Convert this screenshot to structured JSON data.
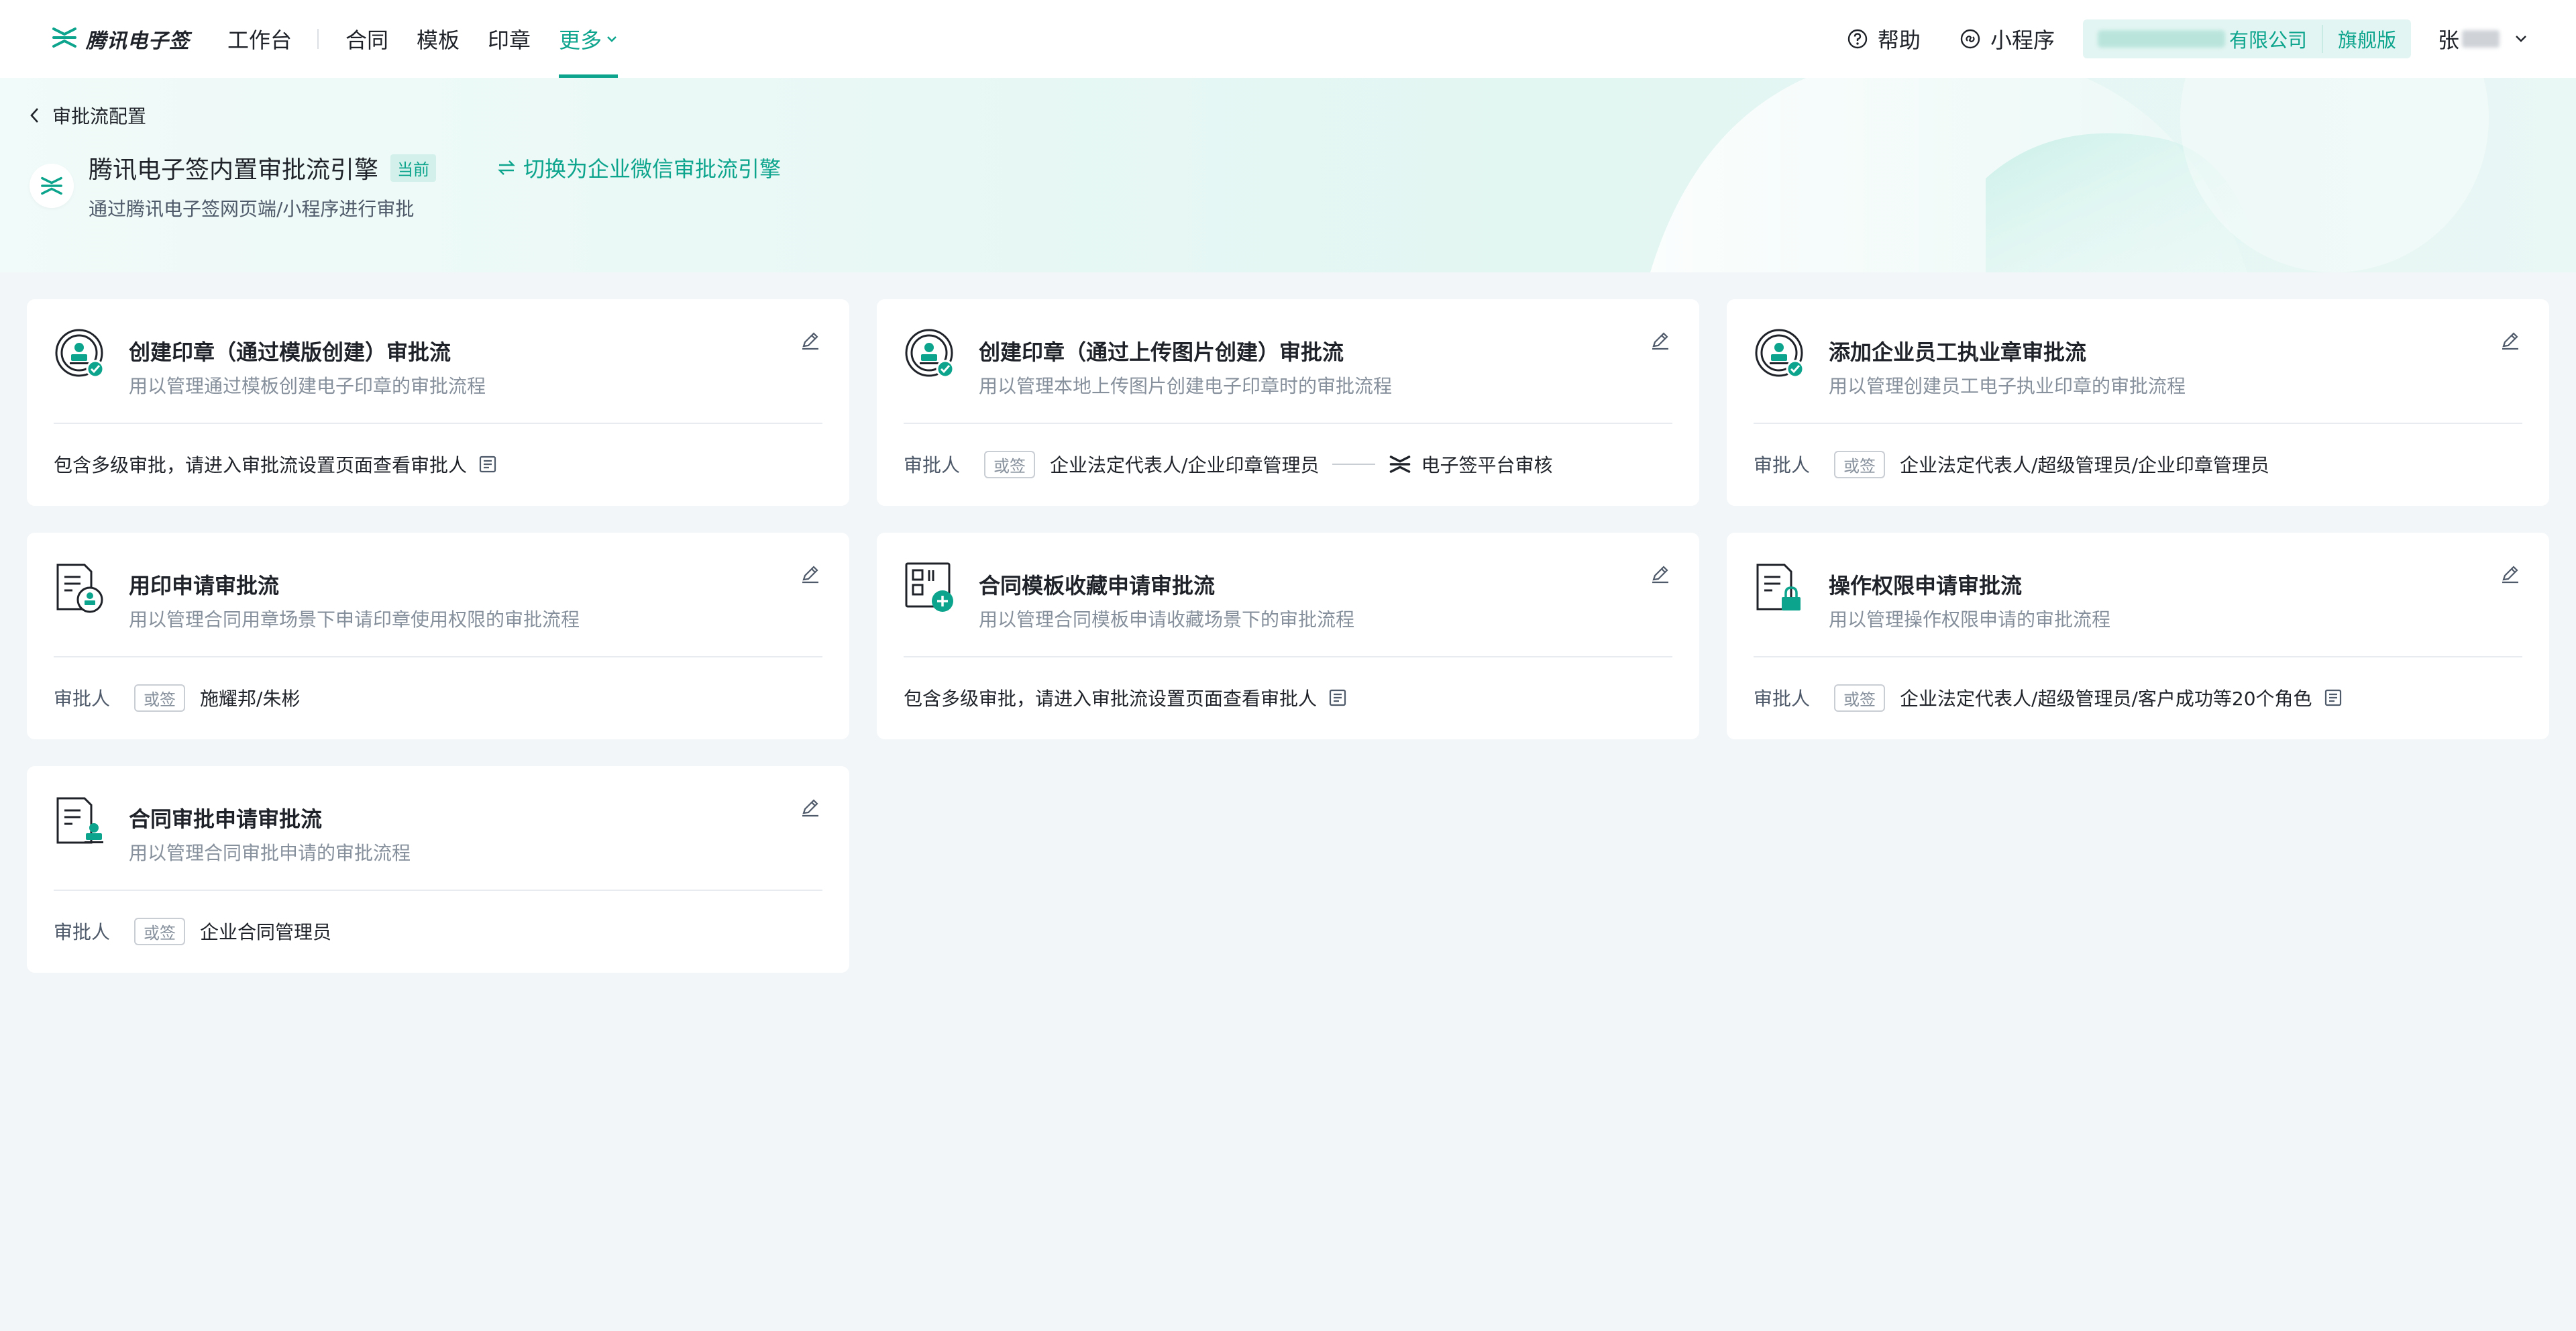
{
  "nav": {
    "logo_text": "腾讯电子签",
    "workbench": "工作台",
    "items": [
      "合同",
      "模板",
      "印章"
    ],
    "more": "更多",
    "help": "帮助",
    "miniprogram": "小程序",
    "company_suffix": "有限公司",
    "edition": "旗舰版",
    "user_initial": "张",
    "accent": "#0ca48c"
  },
  "header": {
    "back_label": "审批流配置",
    "engine_title": "腾讯电子签内置审批流引擎",
    "current_tag": "当前",
    "switch_label": "切换为企业微信审批流引擎",
    "engine_sub": "通过腾讯电子签网页端/小程序进行审批"
  },
  "common": {
    "approver_label": "审批人",
    "or_tag": "或签",
    "multi_level": "包含多级审批，请进入审批流设置页面查看审批人"
  },
  "cards": [
    {
      "title": "创建印章（通过模版创建）审批流",
      "desc": "用以管理通过模板创建电子印章的审批流程"
    },
    {
      "title": "创建印章（通过上传图片创建）审批流",
      "desc": "用以管理本地上传图片创建电子印章时的审批流程",
      "approvers": "企业法定代表人/企业印章管理员",
      "platform": "电子签平台审核"
    },
    {
      "title": "添加企业员工执业章审批流",
      "desc": "用以管理创建员工电子执业印章的审批流程",
      "approvers": "企业法定代表人/超级管理员/企业印章管理员"
    },
    {
      "title": "用印申请审批流",
      "desc": "用以管理合同用章场景下申请印章使用权限的审批流程",
      "approvers": "施耀邦/朱彬"
    },
    {
      "title": "合同模板收藏申请审批流",
      "desc": "用以管理合同模板申请收藏场景下的审批流程"
    },
    {
      "title": "操作权限申请审批流",
      "desc": "用以管理操作权限申请的审批流程",
      "approvers": "企业法定代表人/超级管理员/客户成功等20个角色"
    },
    {
      "title": "合同审批申请审批流",
      "desc": "用以管理合同审批申请的审批流程",
      "approvers": "企业合同管理员"
    }
  ]
}
